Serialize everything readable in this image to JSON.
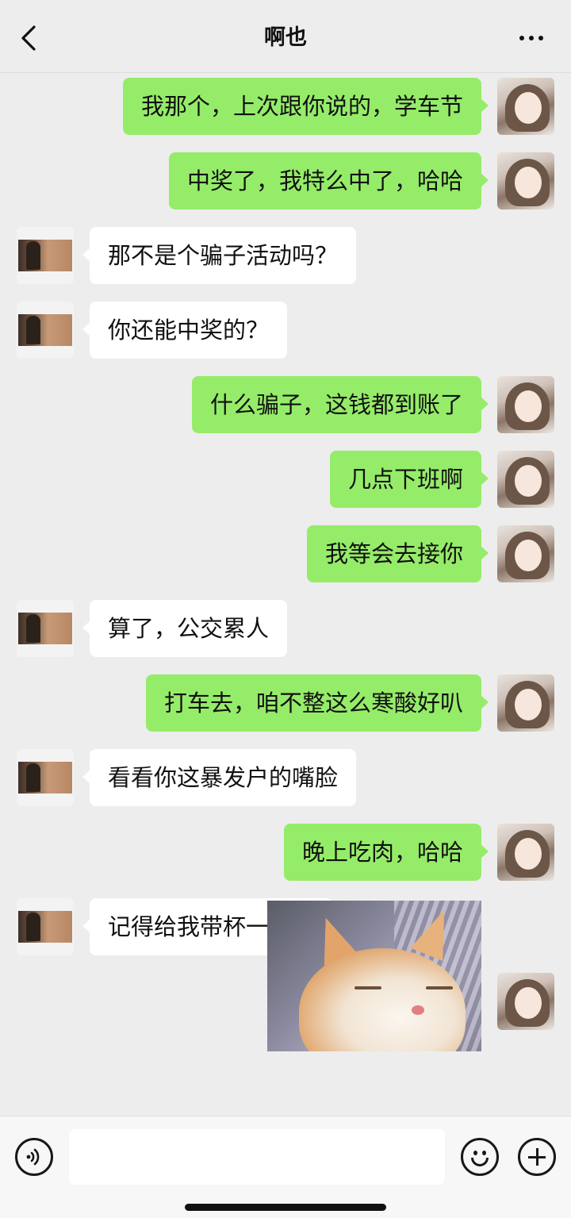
{
  "header": {
    "title": "啊也",
    "back_icon": "chevron-left-icon",
    "more_icon": "more-dots-icon"
  },
  "messages": [
    {
      "from": "me",
      "text": "我那个，上次跟你说的，学车节"
    },
    {
      "from": "me",
      "text": "中奖了，我特么中了，哈哈"
    },
    {
      "from": "them",
      "text": "那不是个骗子活动吗？"
    },
    {
      "from": "them",
      "text": "你还能中奖的？"
    },
    {
      "from": "me",
      "text": "什么骗子，这钱都到账了"
    },
    {
      "from": "me",
      "text": "几点下班啊"
    },
    {
      "from": "me",
      "text": "我等会去接你"
    },
    {
      "from": "them",
      "text": "算了，公交累人"
    },
    {
      "from": "me",
      "text": "打车去，咱不整这么寒酸好叭"
    },
    {
      "from": "them",
      "text": "看看你这暴发户的嘴脸"
    },
    {
      "from": "me",
      "text": "晚上吃肉，哈哈"
    },
    {
      "from": "them",
      "text": "记得给我带杯一点点"
    },
    {
      "from": "me",
      "type": "image",
      "image": "sleeping-cat-photo"
    }
  ],
  "input_bar": {
    "voice_icon": "voice-icon",
    "text_value": "",
    "emoji_icon": "emoji-icon",
    "plus_icon": "plus-icon"
  },
  "colors": {
    "background": "#ededed",
    "my_bubble": "#95ec69",
    "their_bubble": "#ffffff"
  }
}
